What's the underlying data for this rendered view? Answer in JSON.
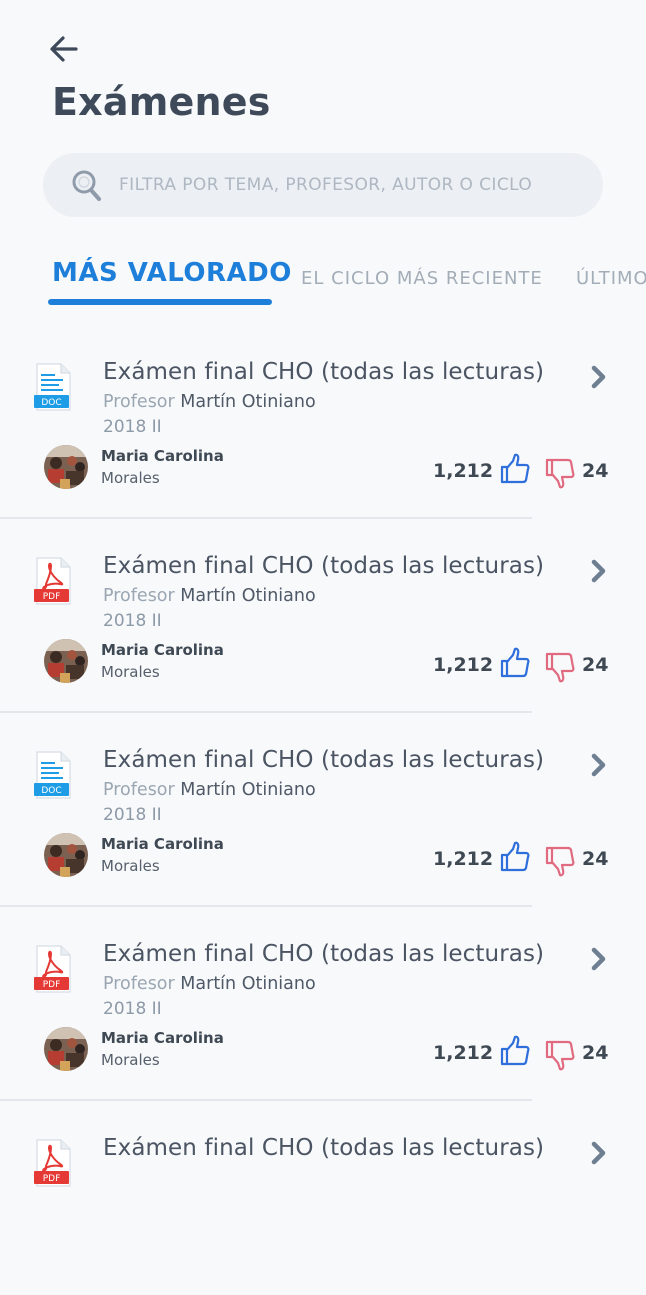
{
  "header": {
    "title": "Exámenes",
    "back_icon": "arrow-left-icon"
  },
  "search": {
    "placeholder": "FILTRA POR TEMA, PROFESOR, AUTOR O CICLO",
    "value": "",
    "icon": "search-icon"
  },
  "tabs": [
    {
      "label": "MÁS VALORADO",
      "active": true
    },
    {
      "label": "EL CICLO MÁS RECIENTE",
      "active": false
    },
    {
      "label": "ÚLTIMOS",
      "active": false
    }
  ],
  "colors": {
    "accent": "#1d7fd9",
    "like": "#2f6fdb",
    "dislike": "#e06b80",
    "pdf": "#e53935",
    "doc": "#1e9de6"
  },
  "exams": [
    {
      "file_type": "DOC",
      "title": "Exámen final CHO (todas las lecturas)",
      "professor_label": "Profesor",
      "professor_name": "Martín Otiniano",
      "cycle": "2018 II",
      "author_first": "Maria Carolina",
      "author_last": "Morales",
      "likes": "1,212",
      "dislikes": "24"
    },
    {
      "file_type": "PDF",
      "title": "Exámen final CHO (todas las lecturas)",
      "professor_label": "Profesor",
      "professor_name": "Martín Otiniano",
      "cycle": "2018 II",
      "author_first": "Maria Carolina",
      "author_last": "Morales",
      "likes": "1,212",
      "dislikes": "24"
    },
    {
      "file_type": "DOC",
      "title": "Exámen final CHO (todas las lecturas)",
      "professor_label": "Profesor",
      "professor_name": "Martín Otiniano",
      "cycle": "2018 II",
      "author_first": "Maria Carolina",
      "author_last": "Morales",
      "likes": "1,212",
      "dislikes": "24"
    },
    {
      "file_type": "PDF",
      "title": "Exámen final CHO (todas las lecturas)",
      "professor_label": "Profesor",
      "professor_name": "Martín Otiniano",
      "cycle": "2018 II",
      "author_first": "Maria Carolina",
      "author_last": "Morales",
      "likes": "1,212",
      "dislikes": "24"
    },
    {
      "file_type": "PDF",
      "title": "Exámen final CHO (todas las lecturas)",
      "professor_label": "",
      "professor_name": "",
      "cycle": "",
      "author_first": "",
      "author_last": "",
      "likes": "",
      "dislikes": ""
    }
  ]
}
